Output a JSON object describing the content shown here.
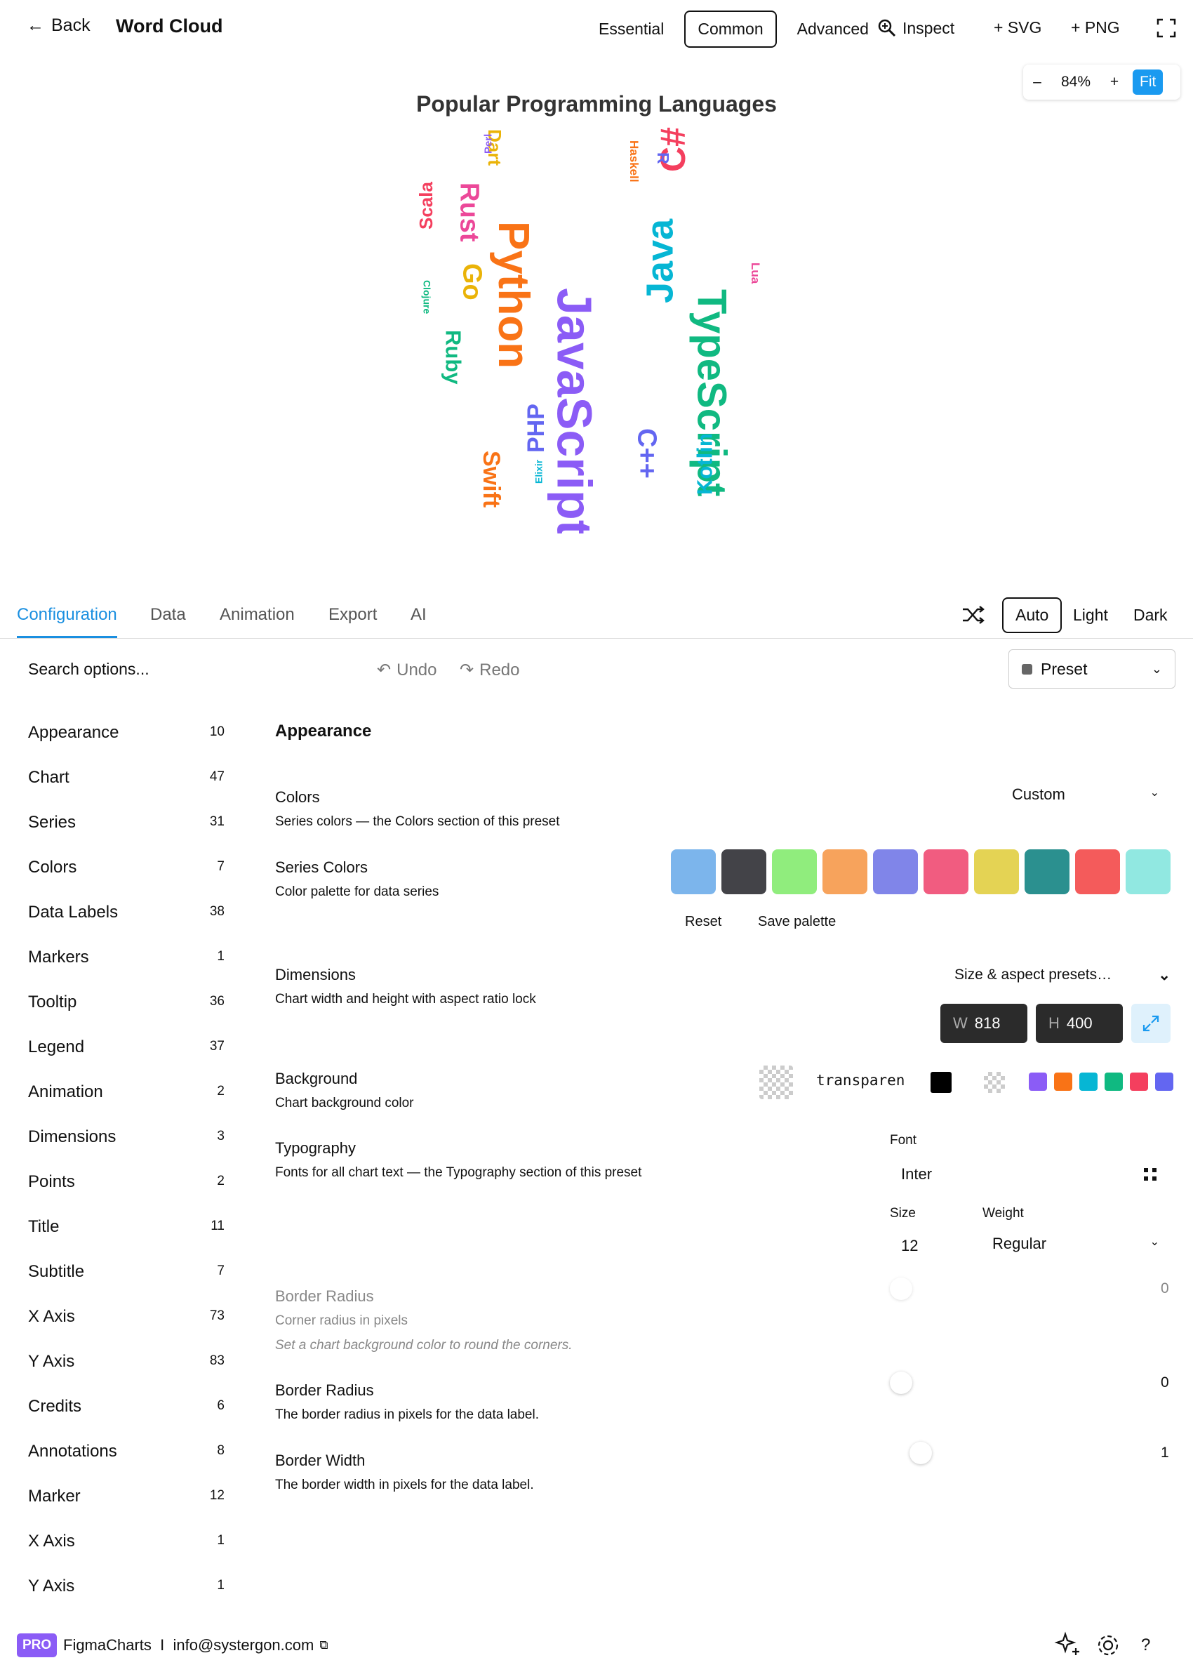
{
  "header": {
    "back_label": "Back",
    "title": "Word Cloud",
    "modes": [
      "Essential",
      "Common",
      "Advanced"
    ],
    "active_mode": "Common",
    "inspect_label": "Inspect",
    "svg_label": "+ SVG",
    "png_label": "+ PNG"
  },
  "zoom": {
    "minus": "–",
    "value": "84%",
    "plus": "+",
    "fit": "Fit"
  },
  "chart_data": {
    "type": "wordcloud",
    "title": "Popular Programming Languages",
    "words": [
      {
        "text": "JavaScript",
        "color": "#8b5cf6"
      },
      {
        "text": "Python",
        "color": "#f97316"
      },
      {
        "text": "TypeScript",
        "color": "#10b981"
      },
      {
        "text": "Java",
        "color": "#06b6d4"
      },
      {
        "text": "C#",
        "color": "#f43f5e"
      },
      {
        "text": "C++",
        "color": "#6366f1"
      },
      {
        "text": "Rust",
        "color": "#ec4899"
      },
      {
        "text": "Go",
        "color": "#eab308"
      },
      {
        "text": "PHP",
        "color": "#6366f1"
      },
      {
        "text": "Swift",
        "color": "#f97316"
      },
      {
        "text": "Ruby",
        "color": "#10b981"
      },
      {
        "text": "Kotlin",
        "color": "#06b6d4"
      },
      {
        "text": "Scala",
        "color": "#f43f5e"
      },
      {
        "text": "Dart",
        "color": "#eab308"
      },
      {
        "text": "R",
        "color": "#6366f1"
      },
      {
        "text": "Haskell",
        "color": "#f97316"
      },
      {
        "text": "Lua",
        "color": "#ec4899"
      },
      {
        "text": "Perl",
        "color": "#8b5cf6"
      },
      {
        "text": "Clojure",
        "color": "#10b981"
      },
      {
        "text": "Elixir",
        "color": "#06b6d4"
      }
    ]
  },
  "tabs": [
    "Configuration",
    "Data",
    "Animation",
    "Export",
    "AI"
  ],
  "active_tab": "Configuration",
  "themes": [
    "Auto",
    "Light",
    "Dark"
  ],
  "active_theme": "Auto",
  "search_placeholder": "Search options...",
  "undo_label": "Undo",
  "redo_label": "Redo",
  "preset_label": "Preset",
  "sidebar": [
    {
      "label": "Appearance",
      "count": "10"
    },
    {
      "label": "Chart",
      "count": "47"
    },
    {
      "label": "Series",
      "count": "31"
    },
    {
      "label": "Colors",
      "count": "7"
    },
    {
      "label": "Data Labels",
      "count": "38"
    },
    {
      "label": "Markers",
      "count": "1"
    },
    {
      "label": "Tooltip",
      "count": "36"
    },
    {
      "label": "Legend",
      "count": "37"
    },
    {
      "label": "Animation",
      "count": "2"
    },
    {
      "label": "Dimensions",
      "count": "3"
    },
    {
      "label": "Points",
      "count": "2"
    },
    {
      "label": "Title",
      "count": "11"
    },
    {
      "label": "Subtitle",
      "count": "7"
    },
    {
      "label": "X Axis",
      "count": "73"
    },
    {
      "label": "Y Axis",
      "count": "83"
    },
    {
      "label": "Credits",
      "count": "6"
    },
    {
      "label": "Annotations",
      "count": "8"
    },
    {
      "label": "Marker",
      "count": "12"
    },
    {
      "label": "X Axis",
      "count": "1"
    },
    {
      "label": "Y Axis",
      "count": "1"
    }
  ],
  "panel": {
    "title": "Appearance",
    "colors": {
      "label": "Colors",
      "desc": "Series colors — the Colors section of this preset",
      "value": "Custom"
    },
    "series_colors": {
      "label": "Series Colors",
      "desc": "Color palette for data series",
      "palette": [
        "#7cb5ec",
        "#434348",
        "#90ed7d",
        "#f7a35c",
        "#8085e9",
        "#f15c80",
        "#e4d354",
        "#2b908f",
        "#f45b5b",
        "#91e8e1"
      ],
      "reset_label": "Reset",
      "save_label": "Save palette"
    },
    "dimensions": {
      "label": "Dimensions",
      "desc": "Chart width and height with aspect ratio lock",
      "presets_label": "Size & aspect presets…",
      "w_key": "W",
      "w_value": "818",
      "h_key": "H",
      "h_value": "400"
    },
    "background": {
      "label": "Background",
      "desc": "Chart background color",
      "value": "transparent",
      "quick_colors": [
        "#8b5cf6",
        "#f97316",
        "#06b6d4",
        "#10b981",
        "#f43f5e",
        "#6366f1"
      ]
    },
    "typography": {
      "label": "Typography",
      "desc": "Fonts for all chart text — the Typography section of this preset",
      "font_label": "Font",
      "font_value": "Inter",
      "size_label": "Size",
      "size_value": "12",
      "weight_label": "Weight",
      "weight_value": "Regular"
    },
    "border_radius_disabled": {
      "label": "Border Radius",
      "desc": "Corner radius in pixels",
      "hint": "Set a chart background color to round the corners.",
      "value": "0"
    },
    "border_radius": {
      "label": "Border Radius",
      "desc": "The border radius in pixels for the data label.",
      "value": "0"
    },
    "border_width": {
      "label": "Border Width",
      "desc": "The border width in pixels for the data label.",
      "value": "1"
    }
  },
  "footer": {
    "badge": "PRO",
    "text": "FigmaCharts  I  info@systergon.com"
  }
}
